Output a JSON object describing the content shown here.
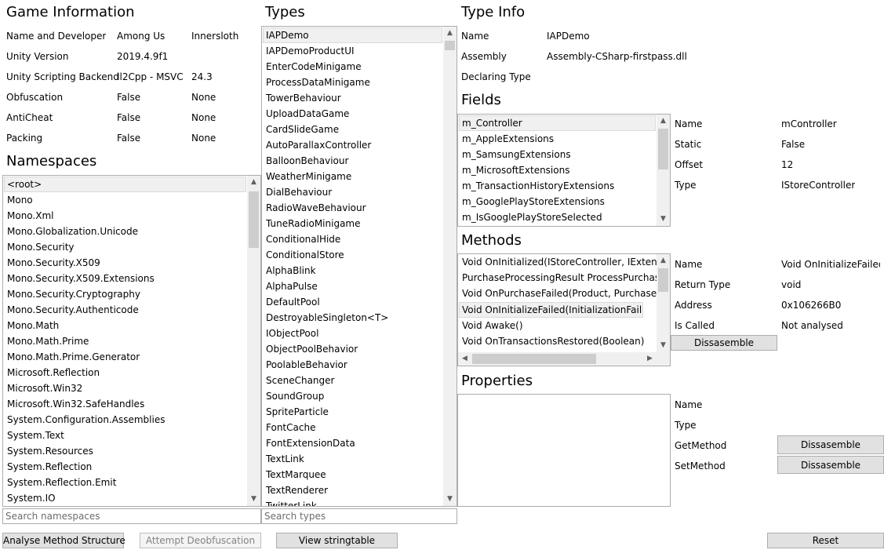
{
  "game_info": {
    "title": "Game Information",
    "rows": [
      {
        "label": "Name and Developer",
        "v1": "Among Us",
        "v2": "Innersloth"
      },
      {
        "label": "Unity Version",
        "v1": "2019.4.9f1",
        "v2": ""
      },
      {
        "label": "Unity Scripting Backend",
        "v1": "Il2Cpp - MSVC",
        "v2": "24.3"
      },
      {
        "label": "Obfuscation",
        "v1": "False",
        "v2": "None"
      },
      {
        "label": "AntiCheat",
        "v1": "False",
        "v2": "None"
      },
      {
        "label": "Packing",
        "v1": "False",
        "v2": "None"
      }
    ]
  },
  "namespaces": {
    "title": "Namespaces",
    "items": [
      "<root>",
      "Mono",
      "Mono.Xml",
      "Mono.Globalization.Unicode",
      "Mono.Security",
      "Mono.Security.X509",
      "Mono.Security.X509.Extensions",
      "Mono.Security.Cryptography",
      "Mono.Security.Authenticode",
      "Mono.Math",
      "Mono.Math.Prime",
      "Mono.Math.Prime.Generator",
      "Microsoft.Reflection",
      "Microsoft.Win32",
      "Microsoft.Win32.SafeHandles",
      "System.Configuration.Assemblies",
      "System.Text",
      "System.Resources",
      "System.Reflection",
      "System.Reflection.Emit",
      "System.IO"
    ],
    "selected_index": 0,
    "search_placeholder": "Search namespaces"
  },
  "types": {
    "title": "Types",
    "items": [
      "IAPDemo",
      "IAPDemoProductUI",
      "EnterCodeMinigame",
      "ProcessDataMinigame",
      "TowerBehaviour",
      "UploadDataGame",
      "CardSlideGame",
      "AutoParallaxController",
      "BalloonBehaviour",
      "WeatherMinigame",
      "DialBehaviour",
      "RadioWaveBehaviour",
      "TuneRadioMinigame",
      "ConditionalHide",
      "ConditionalStore",
      "AlphaBlink",
      "AlphaPulse",
      "DefaultPool",
      "DestroyableSingleton<T>",
      "IObjectPool",
      "ObjectPoolBehavior",
      "PoolableBehavior",
      "SceneChanger",
      "SoundGroup",
      "SpriteParticle",
      "FontCache",
      "FontExtensionData",
      "TextLink",
      "TextMarquee",
      "TextRenderer",
      "TwitterLink"
    ],
    "selected_index": 0,
    "search_placeholder": "Search types"
  },
  "type_info": {
    "title": "Type Info",
    "rows": [
      {
        "label": "Name",
        "value": "IAPDemo"
      },
      {
        "label": "Assembly",
        "value": "Assembly-CSharp-firstpass.dll"
      },
      {
        "label": "Declaring Type",
        "value": ""
      }
    ]
  },
  "fields": {
    "title": "Fields",
    "items": [
      "m_Controller",
      "m_AppleExtensions",
      "m_SamsungExtensions",
      "m_MicrosoftExtensions",
      "m_TransactionHistoryExtensions",
      "m_GooglePlayStoreExtensions",
      "m_IsGooglePlayStoreSelected"
    ],
    "selected_index": 0,
    "detail": [
      {
        "label": "Name",
        "value": "mController"
      },
      {
        "label": "Static",
        "value": "False"
      },
      {
        "label": "Offset",
        "value": "12"
      },
      {
        "label": "Type",
        "value": "IStoreController"
      }
    ]
  },
  "methods": {
    "title": "Methods",
    "items": [
      "Void OnInitialized(IStoreController, IExtensionProvider)",
      "PurchaseProcessingResult ProcessPurchase(PurchaseEventArgs)",
      "Void OnPurchaseFailed(Product, PurchaseFailureReason)",
      "Void OnInitializeFailed(InitializationFailureReason)",
      "Void Awake()",
      "Void OnTransactionsRestored(Boolean)"
    ],
    "selected_index": 3,
    "detail": [
      {
        "label": "Name",
        "value": "Void OnInitializeFailed(InitializationFailureReason)"
      },
      {
        "label": "Return Type",
        "value": "void"
      },
      {
        "label": "Address",
        "value": "0x106266B0"
      },
      {
        "label": "Is Called",
        "value": "Not analysed"
      }
    ],
    "disassemble_label": "Dissasemble"
  },
  "properties": {
    "title": "Properties",
    "detail": [
      {
        "label": "Name",
        "value": ""
      },
      {
        "label": "Type",
        "value": ""
      },
      {
        "label": "GetMethod",
        "value": ""
      },
      {
        "label": "SetMethod",
        "value": ""
      }
    ],
    "get_disassemble_label": "Dissasemble",
    "set_disassemble_label": "Dissasemble"
  },
  "bottom_buttons": {
    "analyse": "Analyse Method Structure",
    "deobfuscate": "Attempt Deobfuscation",
    "stringtable": "View stringtable",
    "reset": "Reset"
  },
  "icons": {
    "scroll_up": "▲",
    "scroll_down": "▼",
    "scroll_left": "◀",
    "scroll_right": "▶"
  }
}
